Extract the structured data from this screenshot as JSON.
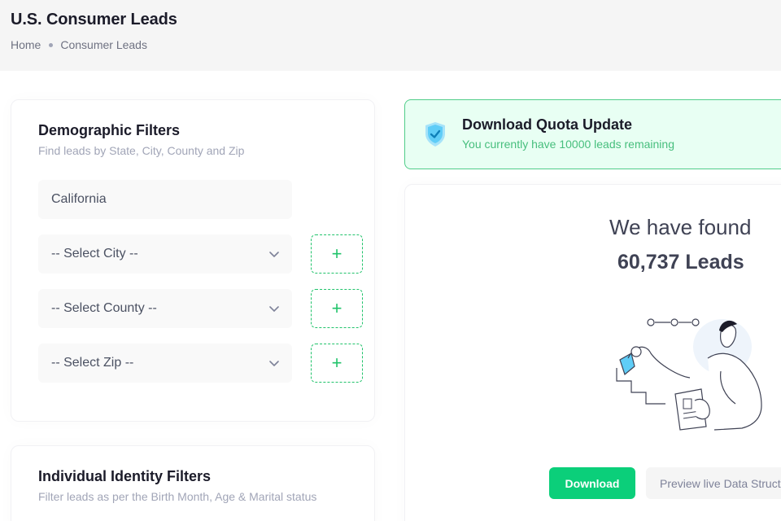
{
  "page": {
    "title": "U.S. Consumer Leads",
    "breadcrumb": [
      "Home",
      "Consumer Leads"
    ]
  },
  "demographic": {
    "title": "Demographic Filters",
    "subtitle": "Find leads by State, City, County and Zip",
    "state_value": "California",
    "city_placeholder": "-- Select City --",
    "county_placeholder": "-- Select County --",
    "zip_placeholder": "-- Select Zip --",
    "add_label": "+"
  },
  "identity": {
    "title": "Individual Identity Filters",
    "subtitle": "Filter leads as per the Birth Month, Age & Marital status"
  },
  "quota": {
    "title": "Download Quota Update",
    "message": "You currently have 10000 leads remaining"
  },
  "results": {
    "heading": "We have found",
    "count": "60,737 Leads",
    "download_label": "Download",
    "preview_label": "Preview live Data Structure"
  },
  "colors": {
    "accent_green": "#0bcf7a",
    "quota_bg": "#e8fff3",
    "quota_border": "#50cd89",
    "shield": "#00b2ff"
  },
  "icons": {
    "quota": "shield-check-icon",
    "select": "chevron-down-icon",
    "add": "plus-icon"
  }
}
